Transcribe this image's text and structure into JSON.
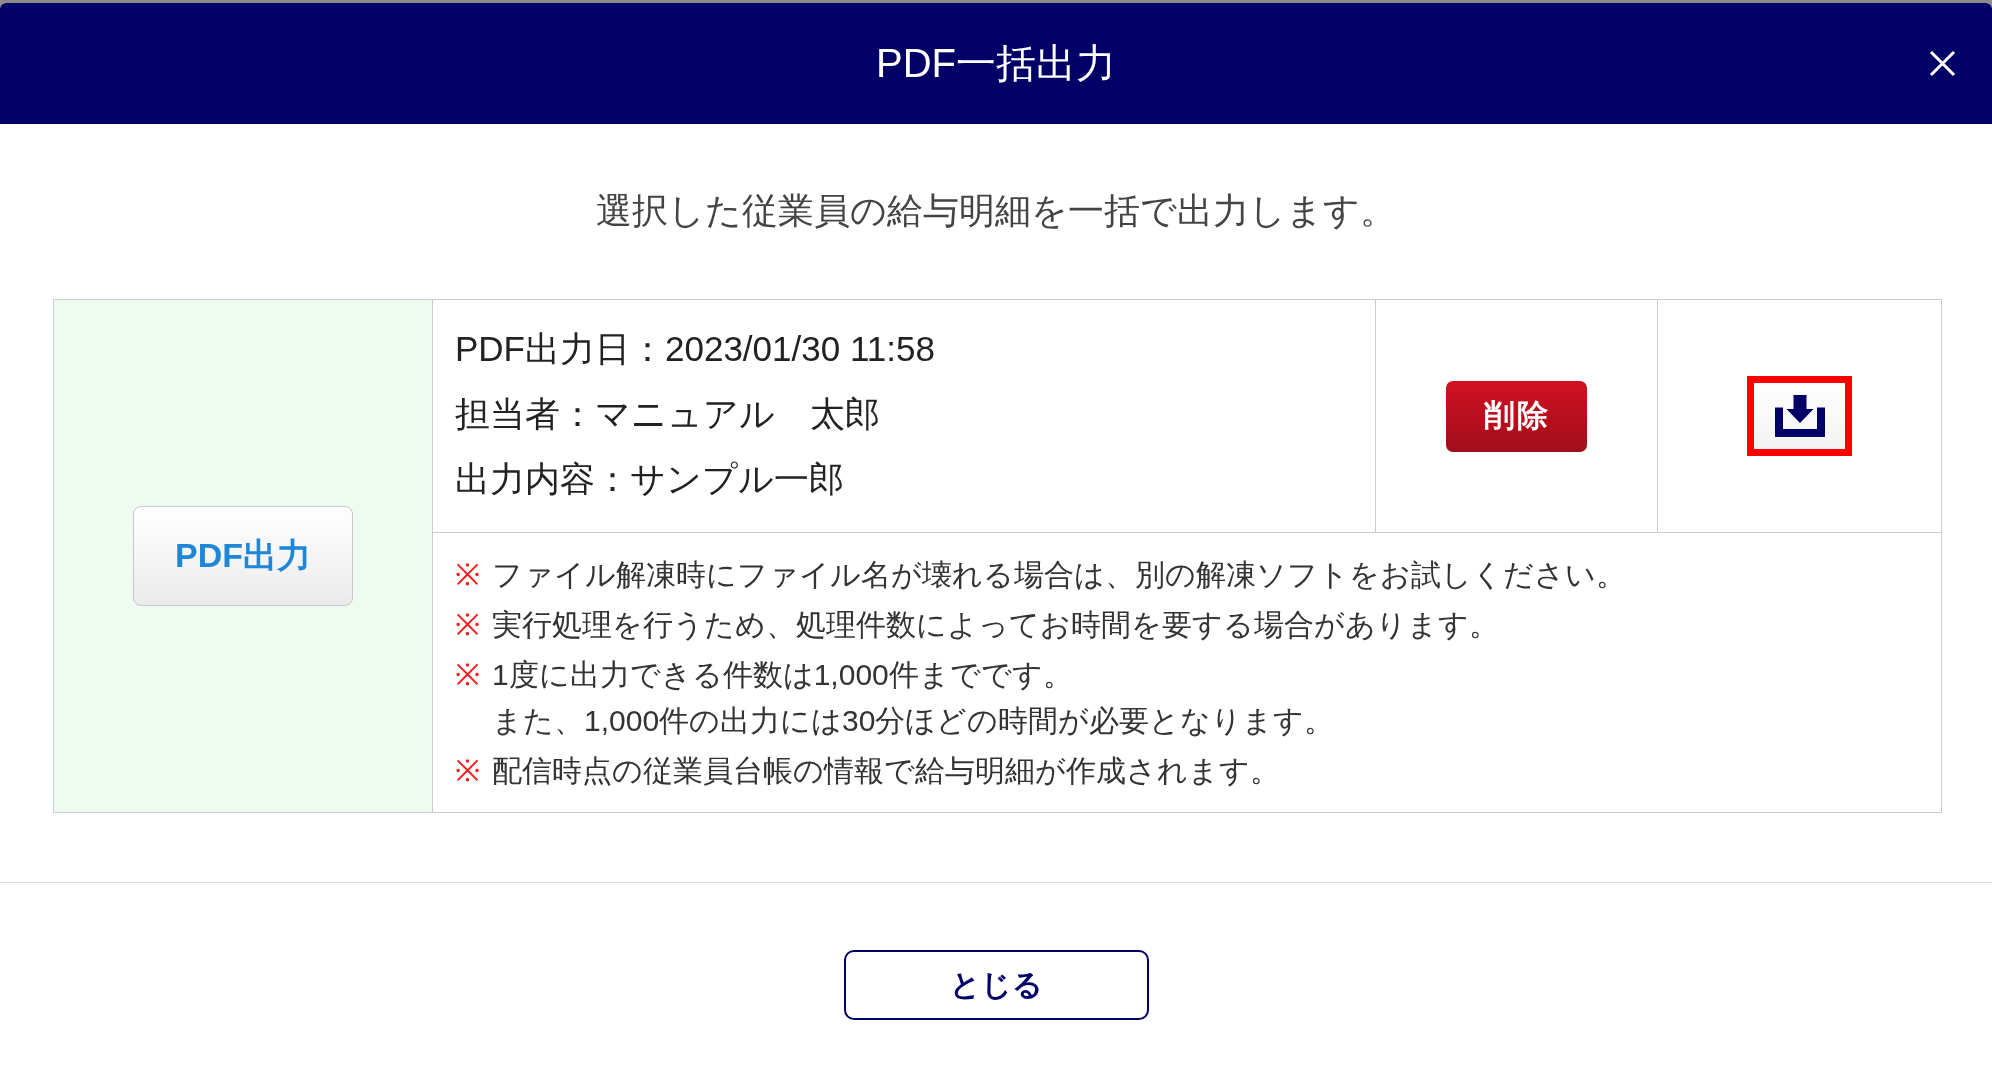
{
  "dialog": {
    "title": "PDF一括出力",
    "description": "選択した従業員の給与明細を一括で出力します。",
    "export_button": {
      "label": "PDF出力"
    },
    "records": [
      {
        "lines": [
          "PDF出力日：2023/01/30 11:58",
          "担当者：マニュアル　太郎",
          "出力内容：サンプル一郎"
        ],
        "delete_button": {
          "label": "削除"
        },
        "download_button": {
          "highlighted": true
        }
      }
    ],
    "notes": [
      {
        "mark": "※",
        "lines": [
          "ファイル解凍時にファイル名が壊れる場合は、別の解凍ソフトをお試しください。"
        ]
      },
      {
        "mark": "※",
        "lines": [
          "実行処理を行うため、処理件数によってお時間を要する場合があります。"
        ]
      },
      {
        "mark": "※",
        "lines": [
          "1度に出力できる件数は1,000件までです。",
          "また、1,000件の出力には30分ほどの時間が必要となります。"
        ]
      },
      {
        "mark": "※",
        "lines": [
          "配信時点の従業員台帳の情報で給与明細が作成されます。"
        ]
      }
    ],
    "close_button": {
      "label": "とじる"
    }
  }
}
